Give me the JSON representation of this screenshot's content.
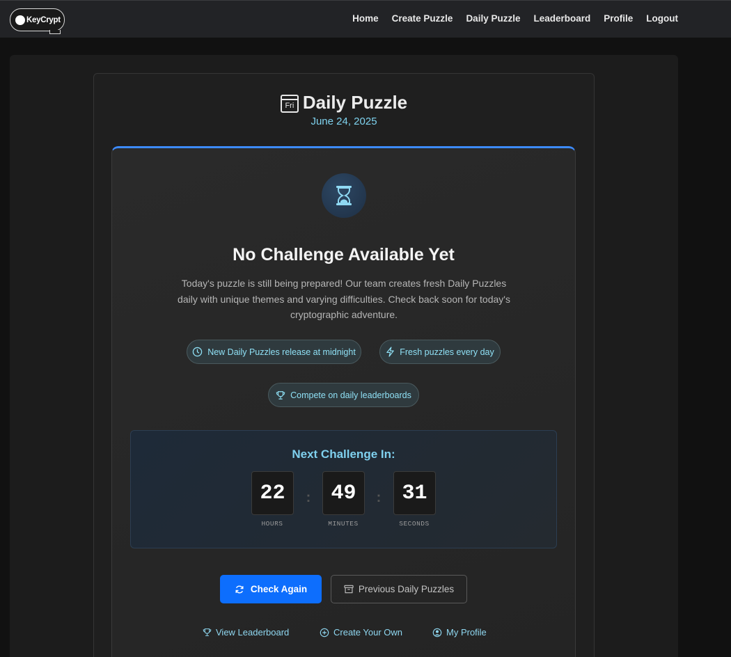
{
  "navbar": {
    "brand": "KeyCrypt",
    "links": [
      "Home",
      "Create Puzzle",
      "Daily Puzzle",
      "Leaderboard",
      "Profile",
      "Logout"
    ]
  },
  "page": {
    "calendar_icon_text": "Fri",
    "title": "Daily Puzzle",
    "date": "June 24, 2025"
  },
  "card": {
    "icon": "hourglass-icon",
    "headline": "No Challenge Available Yet",
    "description": "Today's puzzle is still being prepared! Our team creates fresh Daily Puzzles daily with unique themes and varying difficulties. Check back soon for today's cryptographic adventure.",
    "pills": [
      {
        "icon": "clock-icon",
        "label": "New Daily Puzzles release at midnight"
      },
      {
        "icon": "lightning-icon",
        "label": "Fresh puzzles every day"
      },
      {
        "icon": "trophy-icon",
        "label": "Compete on daily leaderboards"
      }
    ]
  },
  "countdown": {
    "title": "Next Challenge In:",
    "hours": "22",
    "minutes": "49",
    "seconds": "31",
    "hours_label": "HOURS",
    "minutes_label": "MINUTES",
    "seconds_label": "SECONDS",
    "separator": ":"
  },
  "actions": {
    "check_again": "Check Again",
    "previous": "Previous Daily Puzzles"
  },
  "footer_links": {
    "leaderboard": "View Leaderboard",
    "create": "Create Your Own",
    "profile": "My Profile"
  },
  "colors": {
    "accent": "#0d6efd",
    "cyan": "#7fd3ef",
    "background": "#111111"
  }
}
